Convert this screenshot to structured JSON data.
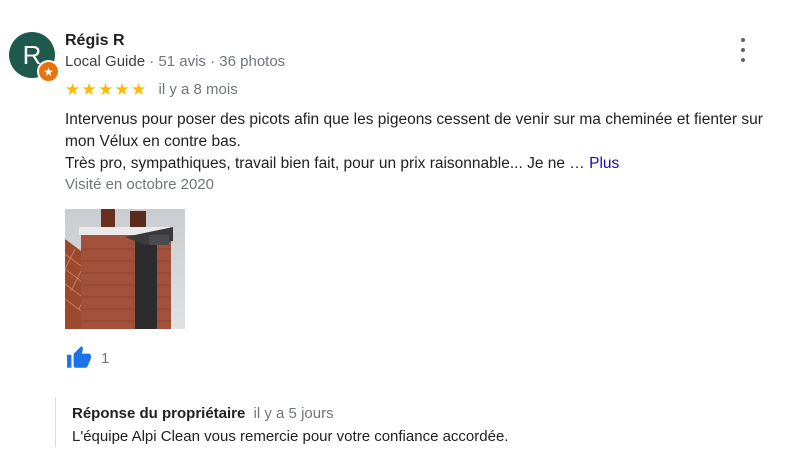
{
  "reviewer": {
    "initial": "R",
    "name": "Régis R",
    "badge": "Local Guide",
    "separator": "·",
    "reviews_count": "51 avis",
    "photos_count": "36 photos",
    "avatar_color": "#1e5a4c",
    "badge_color": "#e8710a"
  },
  "review": {
    "stars": 5,
    "star_color": "#fbbc04",
    "time": "il y a 8 mois",
    "text_line1": "Intervenus pour poser des picots afin que les pigeons cessent de venir sur ma cheminée et fienter sur mon Vélux en contre bas.",
    "text_line2": "Très pro, sympathiques, travail bien fait, pour un prix raisonnable... Je ne …",
    "more_label": "Plus",
    "visited": "Visité en octobre 2020",
    "like_count": "1"
  },
  "owner_reply": {
    "label": "Réponse du propriétaire",
    "time": "il y a 5 jours",
    "text": "L'équipe Alpi Clean vous remercie pour votre confiance accordée."
  },
  "icons": {
    "more": "more-vert-icon",
    "like": "thumb-up-icon",
    "badge": "local-guide-star-icon"
  }
}
